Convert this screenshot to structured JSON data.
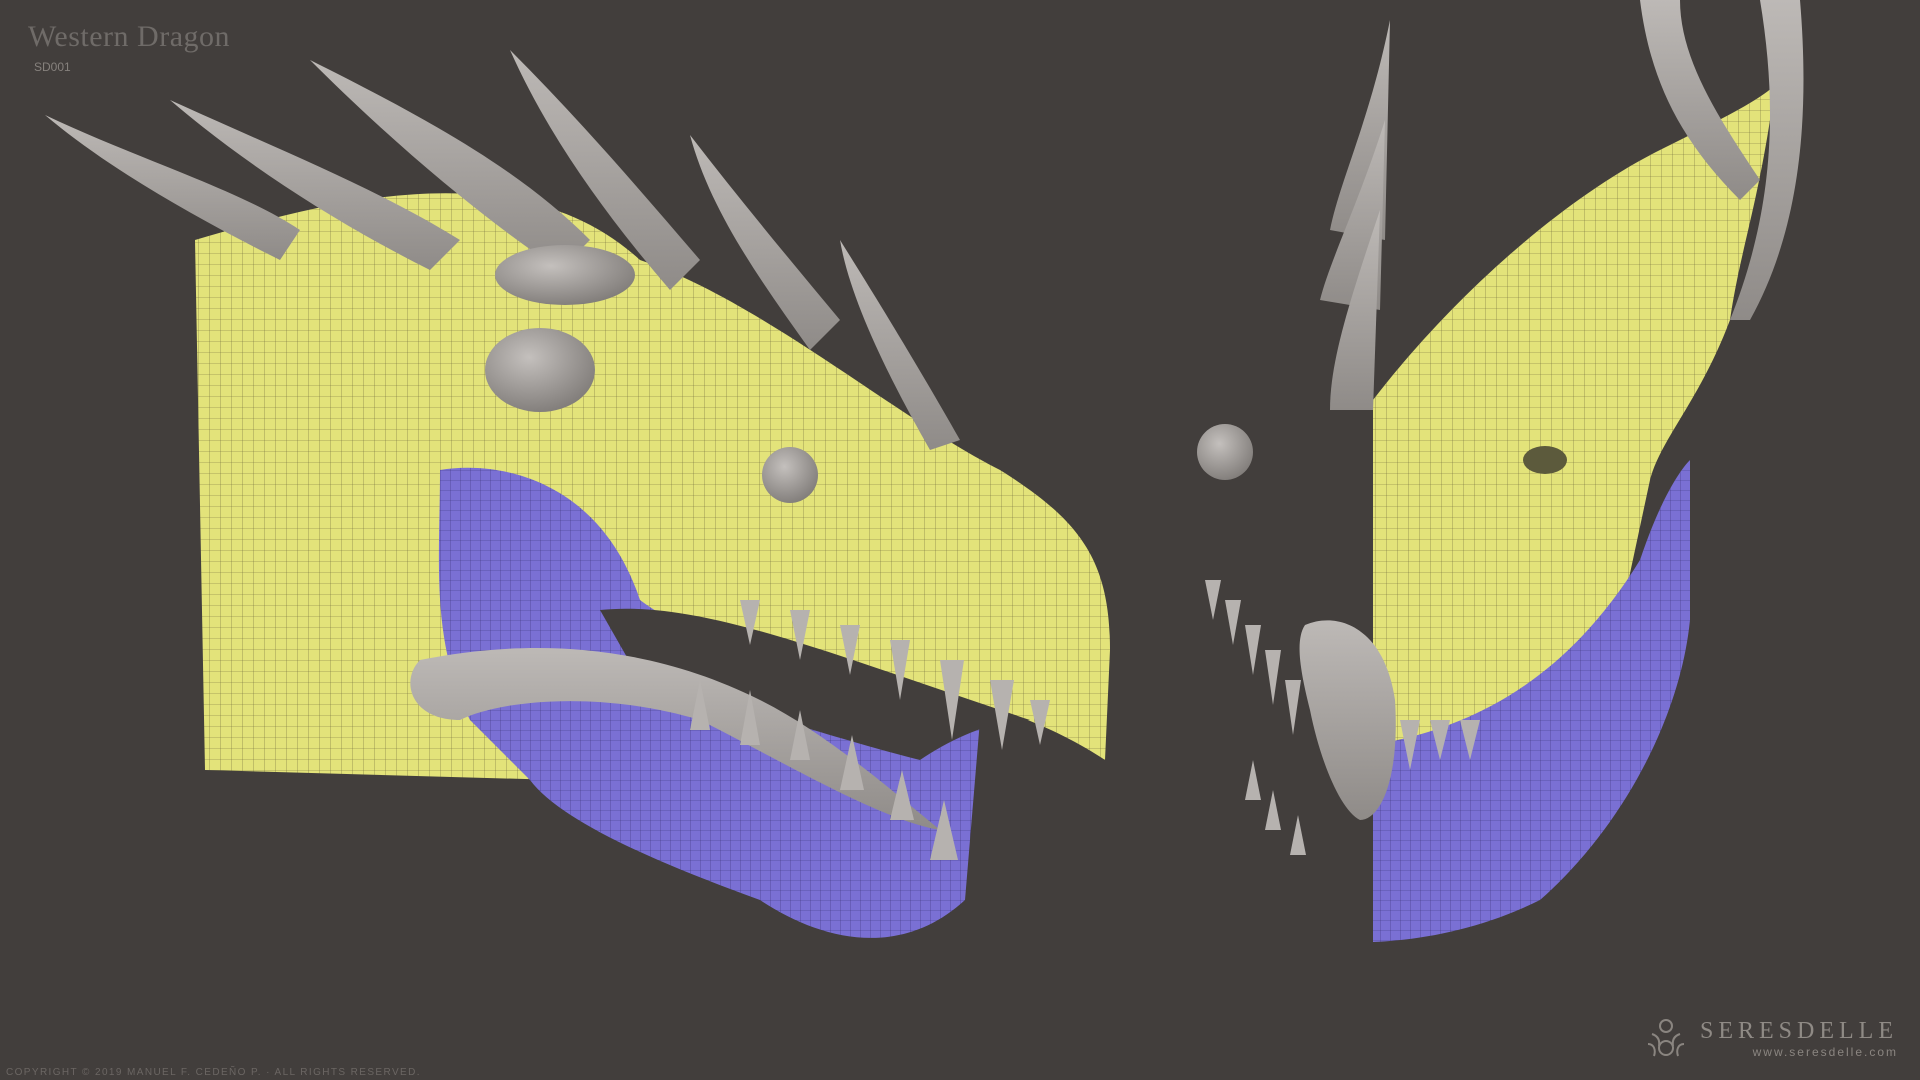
{
  "title": "Western Dragon",
  "code": "SD001",
  "copyright": "COPYRIGHT © 2019 MANUEL F. CEDEÑO P.  ·  ALL RIGHTS RESERVED.",
  "brand": {
    "name": "SERESDELLE",
    "url": "www.seresdelle.com"
  },
  "colors": {
    "background": "#423e3c",
    "skin_mesh": "#e6e67c",
    "jaw_mesh": "#7a72d6",
    "sculpt_gray": "#a9a5a2"
  }
}
